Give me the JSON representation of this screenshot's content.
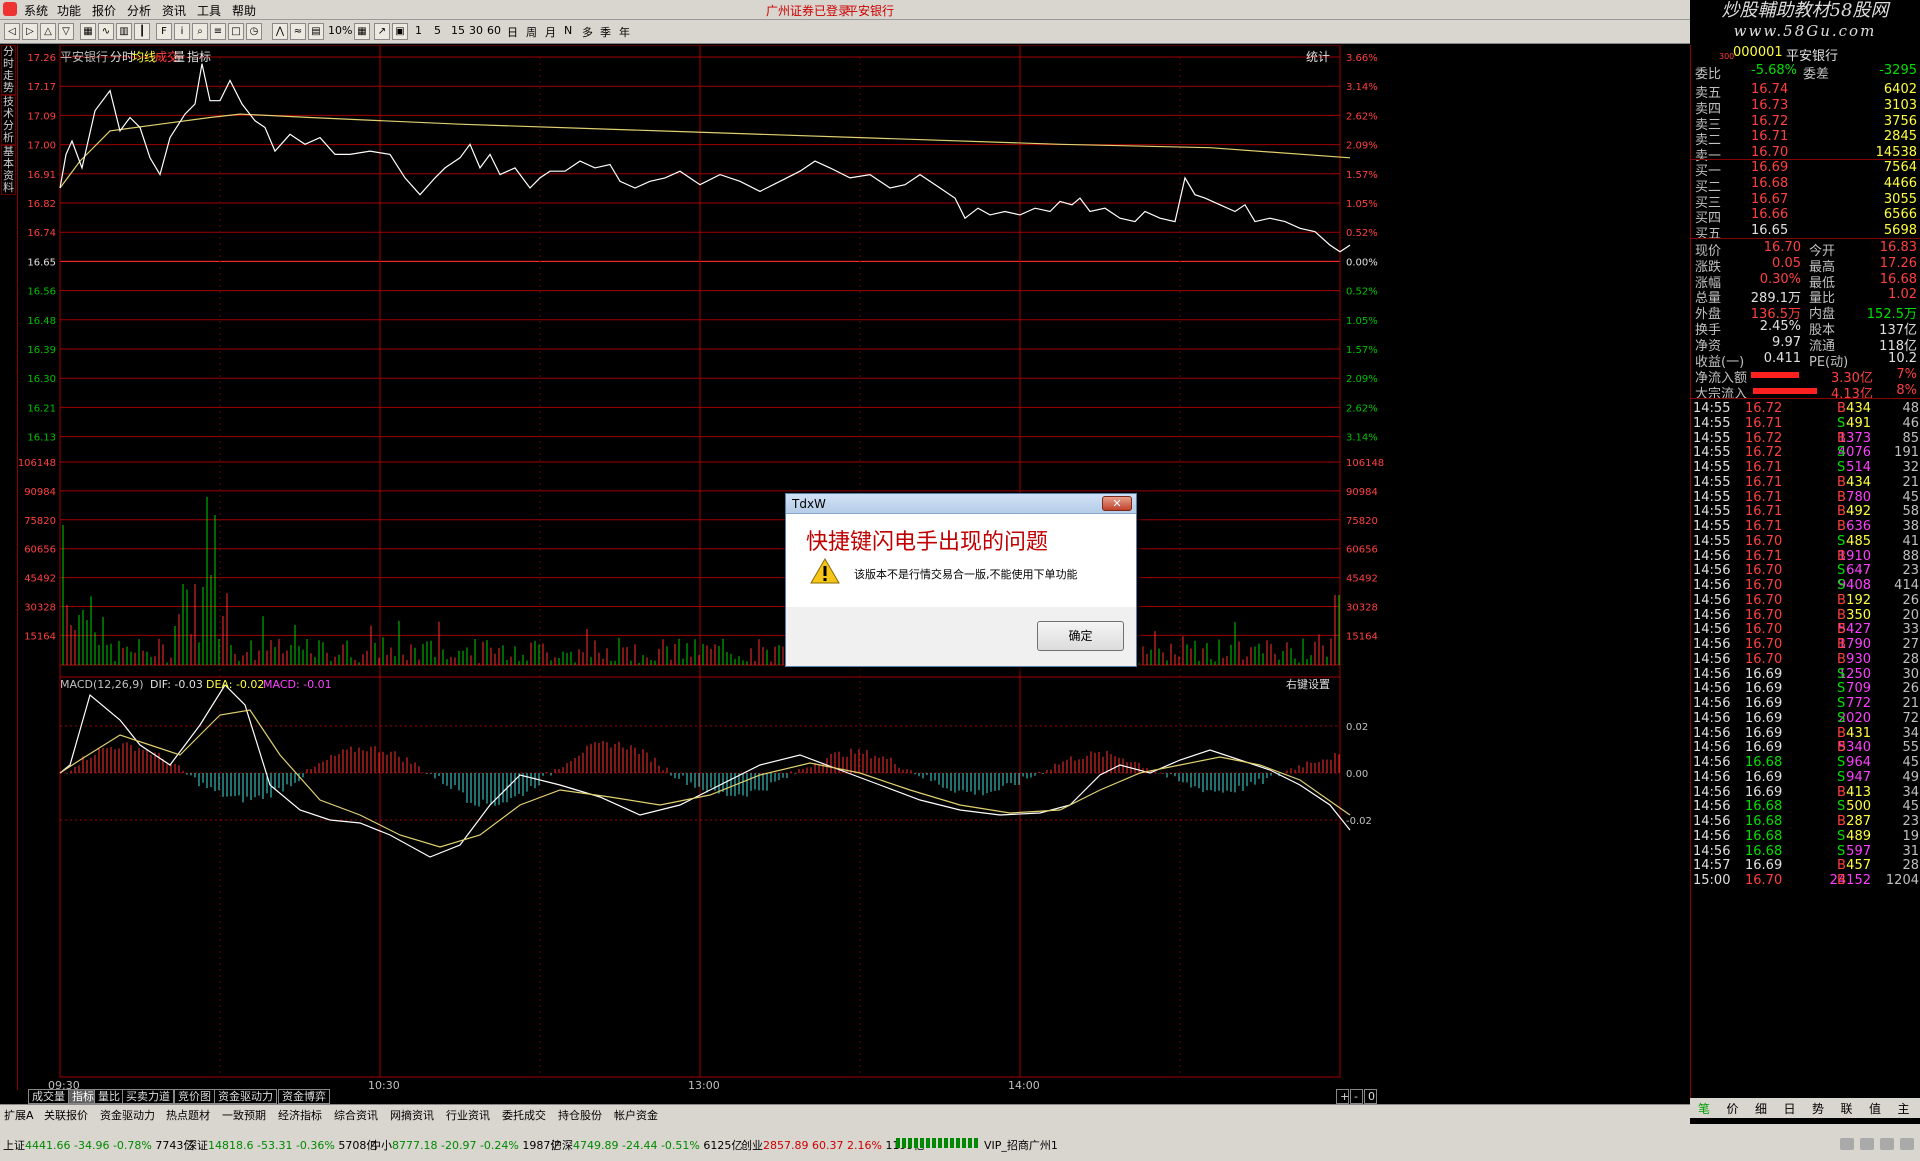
{
  "menu": {
    "items": [
      "系统",
      "功能",
      "报价",
      "分析",
      "资讯",
      "工具",
      "帮助"
    ],
    "status_title": "广州证券已登录",
    "stock_title": "平安银行"
  },
  "brand": {
    "line1": "炒股輔助教材58股网",
    "line2": "www.58Gu.com"
  },
  "toolbar": {
    "zoom_label": "10%",
    "periods": [
      "1",
      "5",
      "15",
      "30",
      "60",
      "日",
      "周",
      "月",
      "N",
      "多",
      "季",
      "年"
    ]
  },
  "left_tabs": [
    "分时走势",
    "技术分析",
    "基本资料"
  ],
  "chart": {
    "header": {
      "name": "平安银行",
      "mode": "分时",
      "avg": "均线",
      "vol": "成交",
      "vol2": "量",
      "ind": "指标",
      "right": "统计"
    },
    "price_labels": [
      "17.26",
      "17.17",
      "17.09",
      "17.00",
      "16.91",
      "16.82",
      "16.74",
      "16.65",
      "16.56",
      "16.48",
      "16.39",
      "16.30",
      "16.21",
      "16.13"
    ],
    "pct_labels": [
      "3.66%",
      "3.14%",
      "2.62%",
      "2.09%",
      "1.57%",
      "1.05%",
      "0.52%",
      "0.00%",
      "0.52%",
      "1.05%",
      "1.57%",
      "2.09%",
      "2.62%",
      "3.14%"
    ],
    "vol_labels": [
      "106148",
      "90984",
      "75820",
      "60656",
      "45492",
      "30328",
      "15164"
    ],
    "macd": {
      "label": "MACD(12,26,9)",
      "dif": "DIF: -0.03",
      "dea": "DEA: -0.02",
      "macd": "MACD: -0.01",
      "right": "右键设置",
      "scale": [
        "0.02",
        "0.00",
        "-0.02"
      ]
    },
    "time_labels": [
      "09:30",
      "10:30",
      "13:00",
      "14:00"
    ],
    "chart_data": {
      "type": "line",
      "prev_close": 16.65,
      "ylim": [
        16.08,
        17.3
      ]
    }
  },
  "bottom_tabs": [
    "成交量",
    "指标",
    "量比",
    "买卖力道",
    "竞价图",
    "资金驱动力",
    "资金博弈"
  ],
  "bottom_tab_ctrl": [
    "+",
    "-",
    "0"
  ],
  "bottom2": [
    "扩展A",
    "关联报价",
    "资金驱动力",
    "热点题材",
    "一致预期",
    "经济指标",
    "综合资讯",
    "网摘资讯",
    "行业资讯",
    "委托成交",
    "持仓股份",
    "帐户资金"
  ],
  "right_panel": {
    "code": "000001",
    "name": "平安银行",
    "market": "300",
    "webi": {
      "l1": "委比",
      "v1": "-5.68%",
      "l2": "委差",
      "v2": "-3295"
    },
    "asks": [
      {
        "l": "卖五",
        "p": "16.74",
        "v": "6402"
      },
      {
        "l": "卖四",
        "p": "16.73",
        "v": "3103"
      },
      {
        "l": "卖三",
        "p": "16.72",
        "v": "3756"
      },
      {
        "l": "卖二",
        "p": "16.71",
        "v": "2845"
      },
      {
        "l": "卖一",
        "p": "16.70",
        "v": "14538"
      }
    ],
    "bids": [
      {
        "l": "买一",
        "p": "16.69",
        "v": "7564"
      },
      {
        "l": "买二",
        "p": "16.68",
        "v": "4466"
      },
      {
        "l": "买三",
        "p": "16.67",
        "v": "3055"
      },
      {
        "l": "买四",
        "p": "16.66",
        "v": "6566"
      },
      {
        "l": "买五",
        "p": "16.65",
        "v": "5698"
      }
    ],
    "stats": [
      {
        "l1": "现价",
        "v1": "16.70",
        "l2": "今开",
        "v2": "16.83"
      },
      {
        "l1": "涨跌",
        "v1": "0.05",
        "l2": "最高",
        "v2": "17.26"
      },
      {
        "l1": "涨幅",
        "v1": "0.30%",
        "l2": "最低",
        "v2": "16.68"
      },
      {
        "l1": "总量",
        "v1": "289.1万",
        "l2": "量比",
        "v2": "1.02"
      },
      {
        "l1": "外盘",
        "v1": "136.5万",
        "l2": "内盘",
        "v2": "152.5万"
      },
      {
        "l1": "换手",
        "v1": "2.45%",
        "l2": "股本",
        "v2": "137亿"
      },
      {
        "l1": "净资",
        "v1": "9.97",
        "l2": "流通",
        "v2": "118亿"
      },
      {
        "l1": "收益(一)",
        "v1": "0.411",
        "l2": "PE(动)",
        "v2": "10.2"
      }
    ],
    "flows": [
      {
        "l": "净流入额",
        "v": "3.30亿",
        "p": "7%"
      },
      {
        "l": "大宗流入",
        "v": "4.13亿",
        "p": "8%"
      }
    ],
    "ticks": [
      [
        "14:55",
        "16.72",
        "434",
        "B",
        "48"
      ],
      [
        "14:55",
        "16.71",
        "491",
        "S",
        "46"
      ],
      [
        "14:55",
        "16.72",
        "1373",
        "B",
        "85"
      ],
      [
        "14:55",
        "16.72",
        "4076",
        "S",
        "191"
      ],
      [
        "14:55",
        "16.71",
        "514",
        "S",
        "32"
      ],
      [
        "14:55",
        "16.71",
        "434",
        "B",
        "21"
      ],
      [
        "14:55",
        "16.71",
        "780",
        "B",
        "45"
      ],
      [
        "14:55",
        "16.71",
        "492",
        "B",
        "58"
      ],
      [
        "14:55",
        "16.71",
        "636",
        "B",
        "38"
      ],
      [
        "14:55",
        "16.70",
        "485",
        "S",
        "41"
      ],
      [
        "14:56",
        "16.71",
        "1910",
        "B",
        "88"
      ],
      [
        "14:56",
        "16.70",
        "647",
        "S",
        "23"
      ],
      [
        "14:56",
        "16.70",
        "9408",
        "S",
        "414"
      ],
      [
        "14:56",
        "16.70",
        "192",
        "B",
        "26"
      ],
      [
        "14:56",
        "16.70",
        "350",
        "B",
        "20"
      ],
      [
        "14:56",
        "16.70",
        "5427",
        "B",
        "33"
      ],
      [
        "14:56",
        "16.70",
        "1790",
        "B",
        "27"
      ],
      [
        "14:56",
        "16.70",
        "930",
        "B",
        "28"
      ],
      [
        "14:56",
        "16.69",
        "1250",
        "S",
        "30"
      ],
      [
        "14:56",
        "16.69",
        "709",
        "S",
        "26"
      ],
      [
        "14:56",
        "16.69",
        "772",
        "S",
        "21"
      ],
      [
        "14:56",
        "16.69",
        "2020",
        "S",
        "72"
      ],
      [
        "14:56",
        "16.69",
        "431",
        "B",
        "34"
      ],
      [
        "14:56",
        "16.69",
        "5340",
        "B",
        "55"
      ],
      [
        "14:56",
        "16.68",
        "964",
        "S",
        "45"
      ],
      [
        "14:56",
        "16.69",
        "947",
        "S",
        "49"
      ],
      [
        "14:56",
        "16.69",
        "413",
        "B",
        "34"
      ],
      [
        "14:56",
        "16.68",
        "500",
        "S",
        "45"
      ],
      [
        "14:56",
        "16.68",
        "287",
        "B",
        "23"
      ],
      [
        "14:56",
        "16.68",
        "489",
        "S",
        "19"
      ],
      [
        "14:56",
        "16.68",
        "597",
        "S",
        "31"
      ],
      [
        "14:57",
        "16.69",
        "457",
        "B",
        "28"
      ],
      [
        "15:00",
        "16.70",
        "24152",
        "B",
        "1204"
      ]
    ],
    "tabs": [
      "笔",
      "价",
      "细",
      "日",
      "势",
      "联",
      "值",
      "主"
    ]
  },
  "dialog": {
    "title": "TdxW",
    "heading": "快捷键闪电手出现的问题",
    "message": "该版本不是行情交易合一版,不能使用下单功能",
    "ok": "确定"
  },
  "status": {
    "items": [
      {
        "n": "上证",
        "v": "4441.66",
        "c": "-34.96",
        "p": "-0.78%",
        "a": "7743亿"
      },
      {
        "n": "深证",
        "v": "14818.6",
        "c": "-53.31",
        "p": "-0.36%",
        "a": "5708亿"
      },
      {
        "n": "中小",
        "v": "8777.18",
        "c": "-20.97",
        "p": "-0.24%",
        "a": "1987亿"
      },
      {
        "n": "沪深",
        "v": "4749.89",
        "c": "-24.44",
        "p": "-0.51%",
        "a": "6125亿"
      },
      {
        "n": "创业",
        "v": "2857.89",
        "c": "60.37",
        "p": "2.16%",
        "a": "1199亿"
      }
    ],
    "vip": "VIP_招商广州1"
  }
}
